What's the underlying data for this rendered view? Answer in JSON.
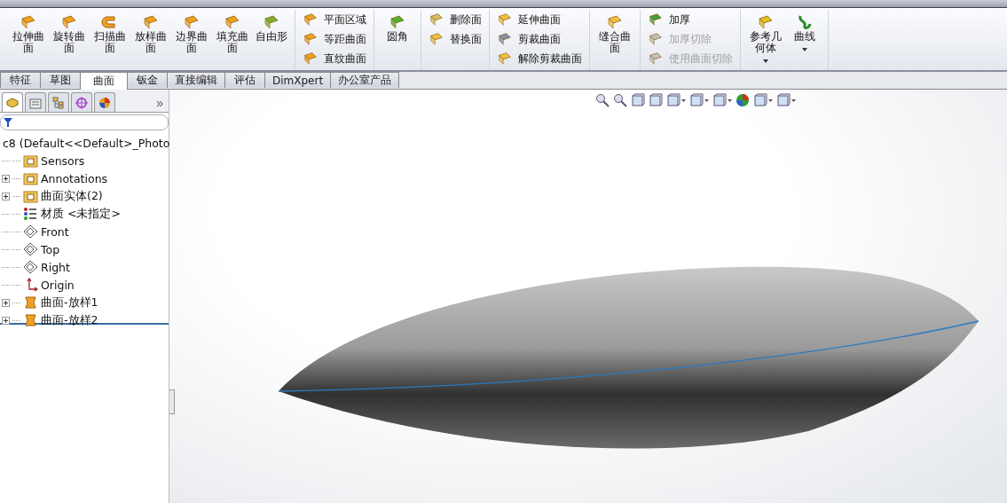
{
  "ribbon": {
    "groups": [
      {
        "kind": "large",
        "items": [
          {
            "label": "拉伸曲面",
            "disabled": false
          },
          {
            "label": "旋转曲面",
            "disabled": false
          },
          {
            "label": "扫描曲面",
            "disabled": false
          },
          {
            "label": "放样曲面",
            "disabled": false
          },
          {
            "label": "边界曲面",
            "disabled": false
          },
          {
            "label": "填充曲面",
            "disabled": false
          },
          {
            "label": "自由形",
            "disabled": false
          }
        ]
      },
      {
        "kind": "small",
        "items": [
          {
            "label": "平面区域",
            "disabled": false
          },
          {
            "label": "等距曲面",
            "disabled": false
          },
          {
            "label": "直纹曲面",
            "disabled": false
          }
        ]
      },
      {
        "kind": "large",
        "items": [
          {
            "label": "圆角",
            "disabled": false
          }
        ]
      },
      {
        "kind": "small",
        "items": [
          {
            "label": "删除面",
            "disabled": false
          },
          {
            "label": "替换面",
            "disabled": false
          }
        ]
      },
      {
        "kind": "small",
        "items": [
          {
            "label": "延伸曲面",
            "disabled": false
          },
          {
            "label": "剪裁曲面",
            "disabled": false
          },
          {
            "label": "解除剪裁曲面",
            "disabled": false
          }
        ]
      },
      {
        "kind": "large",
        "items": [
          {
            "label": "缝合曲面",
            "disabled": false
          }
        ]
      },
      {
        "kind": "small",
        "items": [
          {
            "label": "加厚",
            "disabled": false
          },
          {
            "label": "加厚切除",
            "disabled": true
          },
          {
            "label": "使用曲面切除",
            "disabled": true
          }
        ]
      },
      {
        "kind": "dropdown",
        "items": [
          {
            "label": "参考几何体",
            "disabled": false
          },
          {
            "label": "曲线",
            "disabled": false
          }
        ]
      }
    ]
  },
  "tabs": [
    {
      "label": "特征",
      "selected": false
    },
    {
      "label": "草图",
      "selected": false
    },
    {
      "label": "曲面",
      "selected": true
    },
    {
      "label": "钣金",
      "selected": false
    },
    {
      "label": "直接编辑",
      "selected": false
    },
    {
      "label": "评估",
      "selected": false
    },
    {
      "label": "DimXpert",
      "selected": false
    },
    {
      "label": "办公室产品",
      "selected": false
    }
  ],
  "panel_tabs": [
    {
      "selected": true
    },
    {
      "selected": false
    },
    {
      "selected": false
    },
    {
      "selected": false
    },
    {
      "selected": false
    }
  ],
  "panel_more": "»",
  "tree": {
    "root": "c8  (Default<<Default>_Photo",
    "children": [
      {
        "label": "Sensors",
        "kind": "sensors",
        "expandable": false
      },
      {
        "label": "Annotations",
        "kind": "annotations",
        "expandable": true
      },
      {
        "label": "曲面实体(2)",
        "kind": "bodies",
        "expandable": true
      },
      {
        "label": "材质 <未指定>",
        "kind": "material",
        "expandable": false
      },
      {
        "label": "Front",
        "kind": "plane",
        "expandable": false
      },
      {
        "label": "Top",
        "kind": "plane",
        "expandable": false
      },
      {
        "label": "Right",
        "kind": "plane",
        "expandable": false
      },
      {
        "label": "Origin",
        "kind": "origin",
        "expandable": false
      },
      {
        "label": "曲面-放样1",
        "kind": "loft",
        "expandable": true
      },
      {
        "label": "曲面-放样2",
        "kind": "loft",
        "expandable": true
      }
    ]
  }
}
